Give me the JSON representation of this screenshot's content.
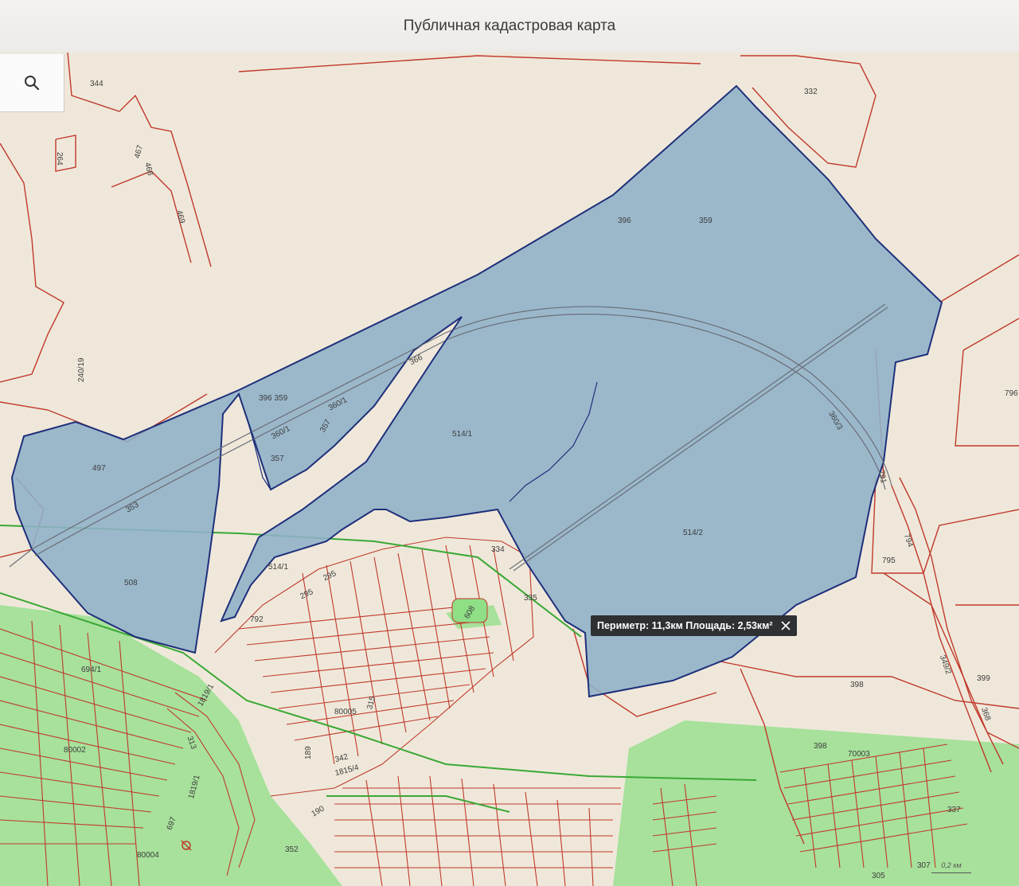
{
  "window": {
    "title": "Публичная кадастровая карта"
  },
  "search": {
    "icon": "search-icon"
  },
  "measurement": {
    "text": "Периметр: 11,3км Площадь: 2,53км²",
    "close_icon": "close-icon"
  },
  "scale": {
    "label": "0,2 км"
  },
  "parcels": {
    "p344": "344",
    "p332": "332",
    "p264": "264",
    "p467": "467",
    "p468": "468",
    "p469": "469",
    "p396": "396",
    "p359": "359",
    "p396_359": "396 359",
    "p360_1a": "360/1",
    "p360_1b": "360/1",
    "p366": "366",
    "p357a": "357",
    "p357b": "357",
    "p497": "497",
    "p353": "353",
    "p514_1a": "514/1",
    "p514_1b": "514/1",
    "p514_2": "514/2",
    "p508": "508",
    "p240_19": "240/19",
    "p796": "796",
    "p360_3": "360/3",
    "p791": "791",
    "p794": "794",
    "p795": "795",
    "p334": "334",
    "p335": "335",
    "p295a": "295",
    "p295b": "295",
    "p792": "792",
    "p608": "608",
    "p694_1": "694/1",
    "p1819_1a": "1819/1",
    "p313": "313",
    "p80005": "80005",
    "p315": "315",
    "p189": "189",
    "p342": "342",
    "p1815_4": "1815/4",
    "p190": "190",
    "p80002": "80002",
    "p1819_1b": "1819/1",
    "p697": "697",
    "p80004": "80004",
    "p352": "352",
    "p398a": "398",
    "p398b": "398",
    "p70003": "70003",
    "p399": "399",
    "p368": "368",
    "p349_2": "349/2",
    "p337": "337",
    "p307": "307",
    "p305": "305"
  },
  "colors": {
    "selection_fill": "#8fb0c8",
    "selection_stroke": "#1f2f7a",
    "boundary": "#c0392b",
    "green_zone": "#8fdf86"
  }
}
